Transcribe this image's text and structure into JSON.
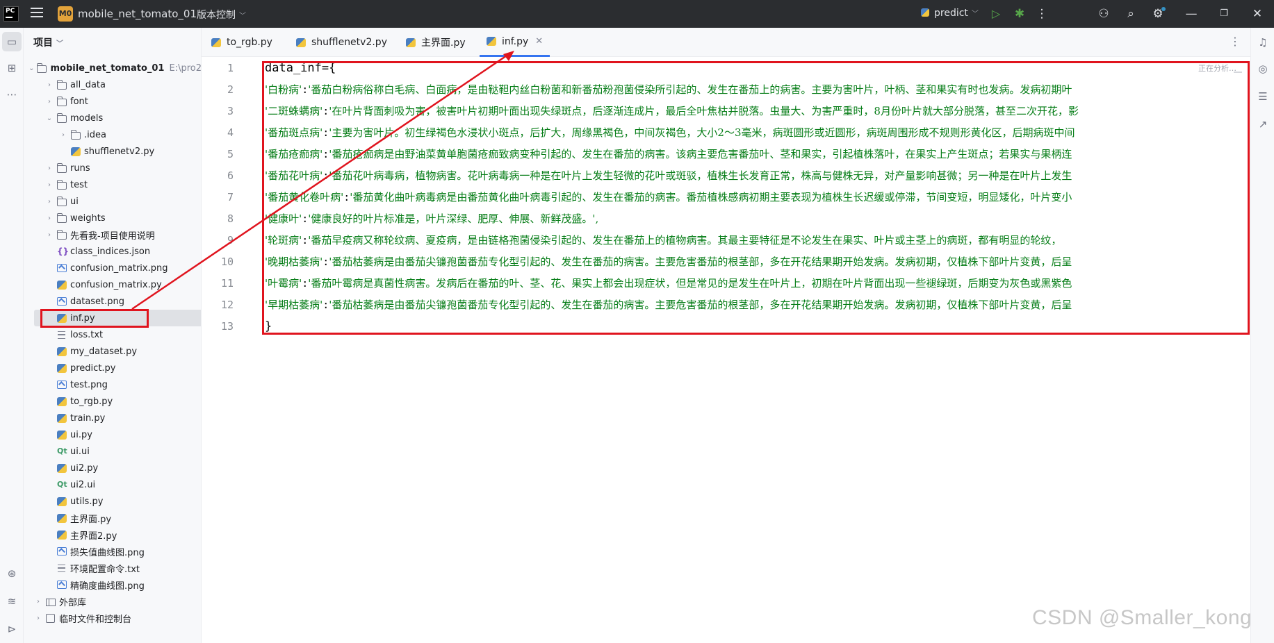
{
  "titlebar": {
    "logo_text": "PC",
    "project_badge": "M0",
    "project_name": "mobile_net_tomato_01",
    "vcs_label": "版本控制",
    "run_config": "predict"
  },
  "project_panel": {
    "header": "项目",
    "root": {
      "name": "mobile_net_tomato_01",
      "path": "E:\\pro2"
    },
    "items": [
      {
        "label": "all_data",
        "type": "folder",
        "depth": 1
      },
      {
        "label": "font",
        "type": "folder",
        "depth": 1
      },
      {
        "label": "models",
        "type": "folder",
        "depth": 1,
        "expanded": true
      },
      {
        "label": ".idea",
        "type": "folder",
        "depth": 2
      },
      {
        "label": "shufflenetv2.py",
        "type": "py",
        "depth": 2
      },
      {
        "label": "runs",
        "type": "folder",
        "depth": 1
      },
      {
        "label": "test",
        "type": "folder",
        "depth": 1
      },
      {
        "label": "ui",
        "type": "folder",
        "depth": 1
      },
      {
        "label": "weights",
        "type": "folder",
        "depth": 1
      },
      {
        "label": "先看我-项目使用说明",
        "type": "folder",
        "depth": 1
      },
      {
        "label": "class_indices.json",
        "type": "json",
        "depth": 1
      },
      {
        "label": "confusion_matrix.png",
        "type": "img",
        "depth": 1
      },
      {
        "label": "confusion_matrix.py",
        "type": "py",
        "depth": 1
      },
      {
        "label": "dataset.png",
        "type": "img",
        "depth": 1
      },
      {
        "label": "inf.py",
        "type": "py",
        "depth": 1,
        "selected": true
      },
      {
        "label": "loss.txt",
        "type": "txt",
        "depth": 1
      },
      {
        "label": "my_dataset.py",
        "type": "py",
        "depth": 1
      },
      {
        "label": "predict.py",
        "type": "py",
        "depth": 1
      },
      {
        "label": "test.png",
        "type": "img",
        "depth": 1
      },
      {
        "label": "to_rgb.py",
        "type": "py",
        "depth": 1
      },
      {
        "label": "train.py",
        "type": "py",
        "depth": 1
      },
      {
        "label": "ui.py",
        "type": "py",
        "depth": 1
      },
      {
        "label": "ui.ui",
        "type": "ui",
        "depth": 1
      },
      {
        "label": "ui2.py",
        "type": "py",
        "depth": 1
      },
      {
        "label": "ui2.ui",
        "type": "ui",
        "depth": 1
      },
      {
        "label": "utils.py",
        "type": "py",
        "depth": 1
      },
      {
        "label": "主界面.py",
        "type": "py",
        "depth": 1
      },
      {
        "label": "主界面2.py",
        "type": "py",
        "depth": 1
      },
      {
        "label": "损失值曲线图.png",
        "type": "img",
        "depth": 1
      },
      {
        "label": "环境配置命令.txt",
        "type": "txt",
        "depth": 1
      },
      {
        "label": "精确度曲线图.png",
        "type": "img",
        "depth": 1
      }
    ],
    "external_libs": "外部库",
    "scratches": "临时文件和控制台"
  },
  "tabs": [
    {
      "label": "to_rgb.py",
      "active": false
    },
    {
      "label": "shufflenetv2.py",
      "active": false
    },
    {
      "label": "主界面.py",
      "active": false
    },
    {
      "label": "inf.py",
      "active": true
    }
  ],
  "editor": {
    "status": "正在分析…",
    "lines": [
      {
        "n": "1",
        "key": "",
        "text": "data_inf={"
      },
      {
        "n": "2",
        "key": "'白粉病'",
        "text": "'番茄白粉病俗称白毛病、白面病，是由鞑靼内丝白粉菌和新番茄粉孢菌侵染所引起的、发生在番茄上的病害。主要为害叶片，叶柄、茎和果实有时也发病。发病初期叶"
      },
      {
        "n": "3",
        "key": "'二斑蛛螨病'",
        "text": "'在叶片背面刺吸为害，被害叶片初期叶面出现失绿斑点，后逐渐连成片，最后全叶焦枯并脱落。虫量大、为害严重时，8月份叶片就大部分脱落，甚至二次开花，影"
      },
      {
        "n": "4",
        "key": "'番茄斑点病'",
        "text": "'主要为害叶片。初生绿褐色水浸状小斑点，后扩大，周缘黑褐色，中间灰褐色，大小2～3毫米，病斑圆形或近圆形，病斑周围形成不规则形黄化区，后期病斑中间"
      },
      {
        "n": "5",
        "key": "'番茄疮痂病'",
        "text": "'番茄疮痂病是由野油菜黄单胞菌疮痂致病变种引起的、发生在番茄的病害。该病主要危害番茄叶、茎和果实，引起植株落叶，在果实上产生斑点；若果实与果柄连"
      },
      {
        "n": "6",
        "key": "'番茄花叶病'",
        "text": "'番茄花叶病毒病，植物病害。花叶病毒病一种是在叶片上发生轻微的花叶或斑驳，植株生长发育正常，株高与健株无异，对产量影响甚微；另一种是在叶片上发生"
      },
      {
        "n": "7",
        "key": "'番茄黄化卷叶病'",
        "text": "'番茄黄化曲叶病毒病是由番茄黄化曲叶病毒引起的、发生在番茄的病害。番茄植株感病初期主要表现为植株生长迟缓或停滞，节间变短，明显矮化，叶片变小"
      },
      {
        "n": "8",
        "key": "'健康叶'",
        "text": "'健康良好的叶片标准是，叶片深绿、肥厚、伸展、新鲜茂盛。',"
      },
      {
        "n": "9",
        "key": "'轮斑病'",
        "text": "'番茄早疫病又称轮纹病、夏疫病，是由链格孢菌侵染引起的、发生在番茄上的植物病害。其最主要特征是不论发生在果实、叶片或主茎上的病斑，都有明显的轮纹，"
      },
      {
        "n": "10",
        "key": "'晚期枯萎病'",
        "text": "'番茄枯萎病是由番茄尖镰孢菌番茄专化型引起的、发生在番茄的病害。主要危害番茄的根茎部，多在开花结果期开始发病。发病初期，仅植株下部叶片变黄，后呈"
      },
      {
        "n": "11",
        "key": "'叶霉病'",
        "text": "'番茄叶霉病是真菌性病害。发病后在番茄的叶、茎、花、果实上都会出现症状，但是常见的是发生在叶片上，初期在叶片背面出现一些褪绿斑，后期变为灰色或黑紫色"
      },
      {
        "n": "12",
        "key": "'早期枯萎病'",
        "text": "'番茄枯萎病是由番茄尖镰孢菌番茄专化型引起的、发生在番茄的病害。主要危害番茄的根茎部，多在开花结果期开始发病。发病初期，仅植株下部叶片变黄，后呈"
      },
      {
        "n": "13",
        "key": "",
        "text": "}"
      }
    ]
  },
  "watermark": "CSDN @Smaller_kong"
}
